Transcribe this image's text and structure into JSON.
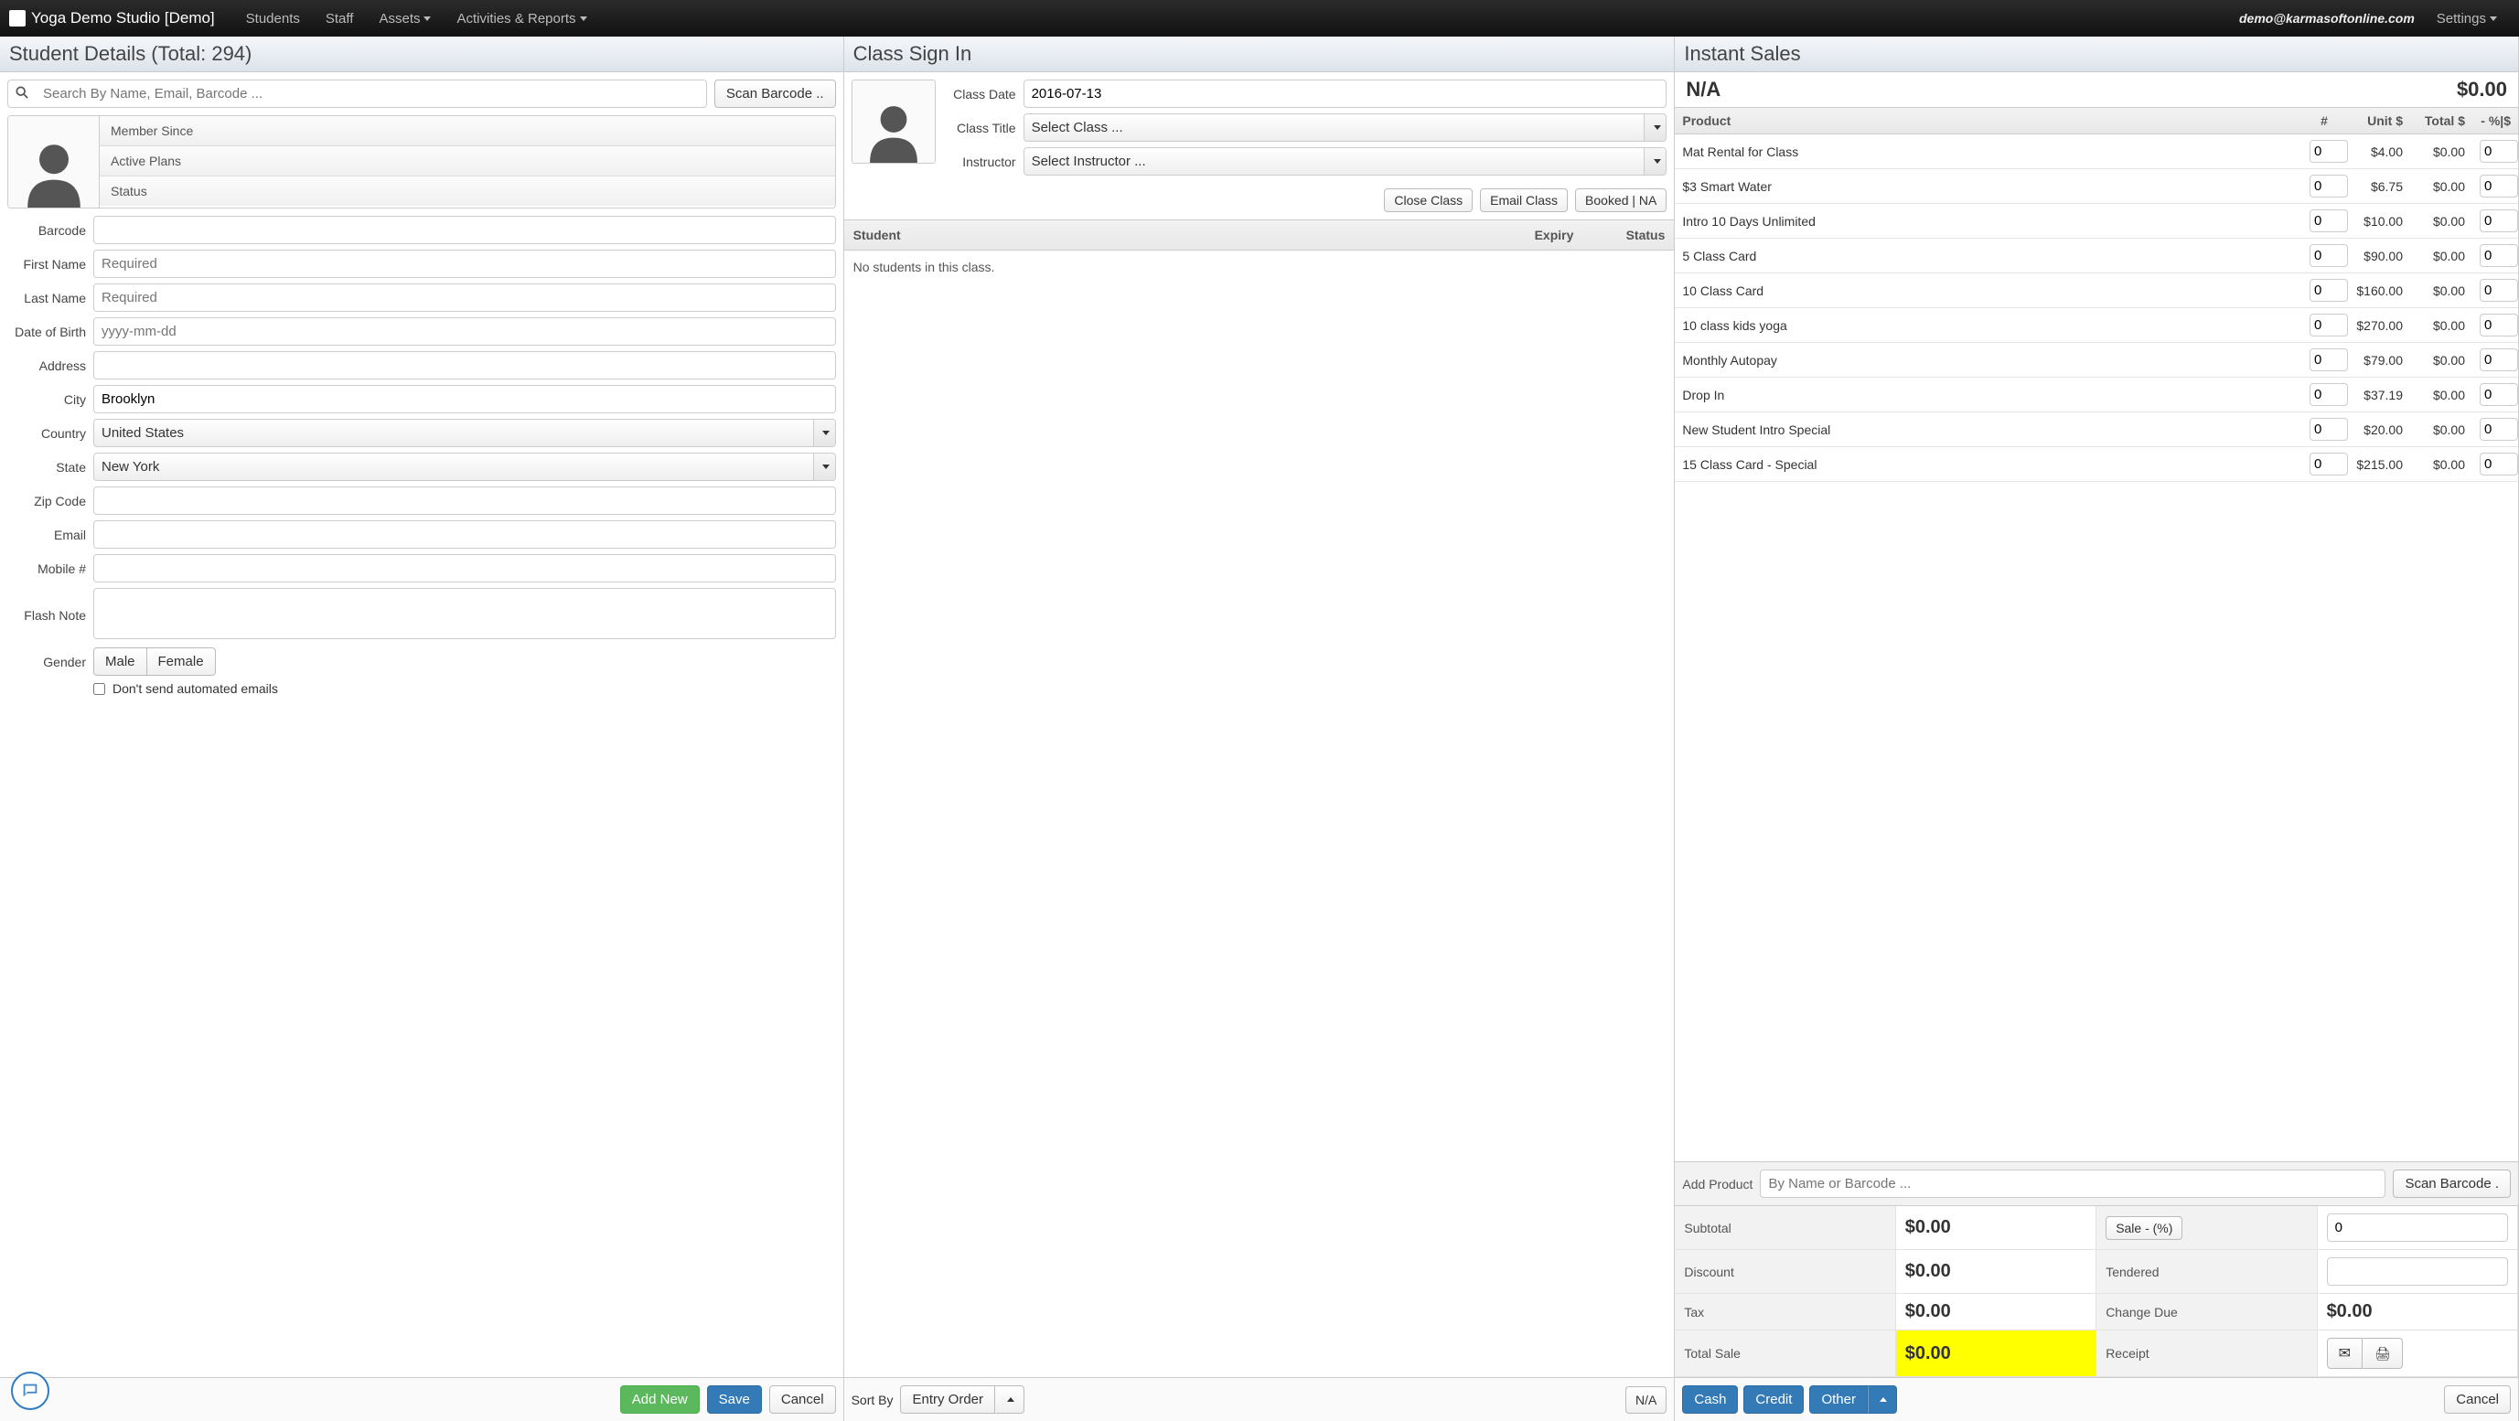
{
  "navbar": {
    "brand": "Yoga Demo Studio [Demo]",
    "items": [
      "Students",
      "Staff",
      "Assets",
      "Activities & Reports"
    ],
    "email": "demo@karmasoftonline.com",
    "settings": "Settings"
  },
  "left": {
    "title": "Student Details (Total: 294)",
    "search_placeholder": "Search By Name, Email, Barcode ...",
    "scan_barcode": "Scan Barcode ..",
    "card": {
      "member_since": "Member Since",
      "active_plans": "Active Plans",
      "status": "Status"
    },
    "labels": {
      "barcode": "Barcode",
      "first_name": "First Name",
      "last_name": "Last Name",
      "dob": "Date of Birth",
      "address": "Address",
      "city": "City",
      "country": "Country",
      "state": "State",
      "zip": "Zip Code",
      "email": "Email",
      "mobile": "Mobile #",
      "flash": "Flash Note",
      "gender": "Gender"
    },
    "placeholders": {
      "required": "Required",
      "dob": "yyyy-mm-dd"
    },
    "values": {
      "barcode": "",
      "first_name": "",
      "last_name": "",
      "dob": "",
      "address": "",
      "city": "Brooklyn",
      "country": "United States",
      "state": "New York",
      "zip": "",
      "email": "",
      "mobile": "",
      "flash": ""
    },
    "gender": {
      "male": "Male",
      "female": "Female"
    },
    "no_auto_email": "Don't send automated emails",
    "buttons": {
      "add_new": "Add New",
      "save": "Save",
      "cancel": "Cancel"
    }
  },
  "mid": {
    "title": "Class Sign In",
    "labels": {
      "date": "Class Date",
      "title": "Class Title",
      "instructor": "Instructor"
    },
    "values": {
      "date": "2016-07-13",
      "title": "Select Class ...",
      "instructor": "Select Instructor ..."
    },
    "actions": {
      "close": "Close Class",
      "email": "Email Class",
      "booked": "Booked | NA"
    },
    "columns": {
      "student": "Student",
      "expiry": "Expiry",
      "status": "Status"
    },
    "empty": "No students in this class.",
    "footer": {
      "sort_by": "Sort By",
      "sort_value": "Entry Order",
      "na": "N/A"
    }
  },
  "right": {
    "title": "Instant Sales",
    "customer": "N/A",
    "customer_total": "$0.00",
    "columns": {
      "product": "Product",
      "qty": "#",
      "unit": "Unit $",
      "total": "Total $",
      "disc": "- %|$"
    },
    "products": [
      {
        "name": "Mat Rental for Class",
        "qty": "0",
        "unit": "$4.00",
        "total": "$0.00",
        "disc": "0"
      },
      {
        "name": "$3 Smart Water",
        "qty": "0",
        "unit": "$6.75",
        "total": "$0.00",
        "disc": "0"
      },
      {
        "name": "Intro 10 Days Unlimited",
        "qty": "0",
        "unit": "$10.00",
        "total": "$0.00",
        "disc": "0"
      },
      {
        "name": "5 Class Card",
        "qty": "0",
        "unit": "$90.00",
        "total": "$0.00",
        "disc": "0"
      },
      {
        "name": "10 Class Card",
        "qty": "0",
        "unit": "$160.00",
        "total": "$0.00",
        "disc": "0"
      },
      {
        "name": "10 class kids yoga",
        "qty": "0",
        "unit": "$270.00",
        "total": "$0.00",
        "disc": "0"
      },
      {
        "name": "Monthly Autopay",
        "qty": "0",
        "unit": "$79.00",
        "total": "$0.00",
        "disc": "0"
      },
      {
        "name": "Drop In",
        "qty": "0",
        "unit": "$37.19",
        "total": "$0.00",
        "disc": "0"
      },
      {
        "name": "New Student Intro Special",
        "qty": "0",
        "unit": "$20.00",
        "total": "$0.00",
        "disc": "0"
      },
      {
        "name": "15 Class Card - Special",
        "qty": "0",
        "unit": "$215.00",
        "total": "$0.00",
        "disc": "0"
      }
    ],
    "add_product": {
      "label": "Add Product",
      "placeholder": "By Name or Barcode ...",
      "scan": "Scan Barcode ."
    },
    "totals": {
      "subtotal_l": "Subtotal",
      "subtotal_v": "$0.00",
      "sale_btn": "Sale - (%)",
      "sale_input": "0",
      "discount_l": "Discount",
      "discount_v": "$0.00",
      "tendered_l": "Tendered",
      "tendered_v": "",
      "tax_l": "Tax",
      "tax_v": "$0.00",
      "change_l": "Change Due",
      "change_v": "$0.00",
      "total_l": "Total Sale",
      "total_v": "$0.00",
      "receipt_l": "Receipt"
    },
    "footer": {
      "cash": "Cash",
      "credit": "Credit",
      "other": "Other",
      "cancel": "Cancel"
    }
  }
}
